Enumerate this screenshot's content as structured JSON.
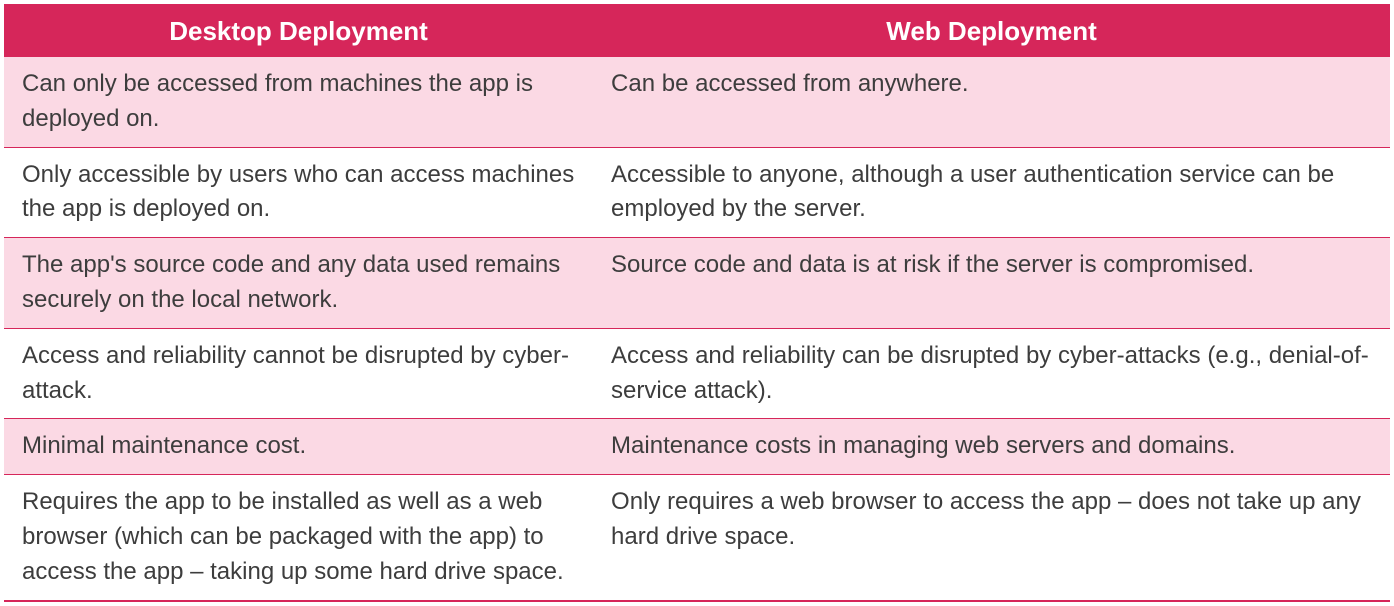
{
  "table": {
    "headers": {
      "col1": "Desktop Deployment",
      "col2": "Web Deployment"
    },
    "rows": [
      {
        "col1": "Can only be accessed from machines the app is deployed on.",
        "col2": "Can be accessed from anywhere."
      },
      {
        "col1": "Only accessible by users who can access machines the app is deployed on.",
        "col2": "Accessible to anyone, although a user authentication service can be employed by the server."
      },
      {
        "col1": "The app's source code and any data used remains securely on the local network.",
        "col2": "Source code and data is at risk if the server is compromised."
      },
      {
        "col1": "Access and reliability cannot be disrupted by cyber-attack.",
        "col2": "Access and reliability can be disrupted by cyber-attacks (e.g., denial-of-service attack)."
      },
      {
        "col1": "Minimal maintenance cost.",
        "col2": "Maintenance costs in managing web servers and domains."
      },
      {
        "col1": "Requires the app to be installed as well as a web browser (which can be packaged with the app) to access the app – taking up some hard drive space.",
        "col2": "Only requires a web browser to access the app – does not take up any hard drive space."
      }
    ]
  }
}
